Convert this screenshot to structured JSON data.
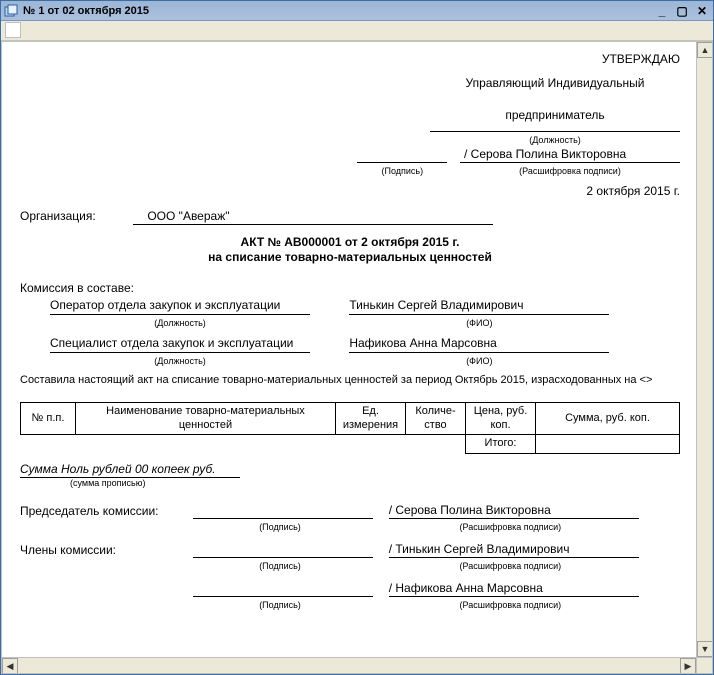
{
  "window": {
    "title": "№ 1 от 02 октября 2015"
  },
  "approve": {
    "header": "УТВЕРЖДАЮ",
    "position": "Управляющий Индивидуальный предприниматель",
    "position_caption": "(Должность)",
    "name": "/ Серова Полина Викторовна",
    "sign_caption": "(Подпись)",
    "name_caption": "(Расшифровка подписи)",
    "date": "2 октября 2015 г."
  },
  "org": {
    "label": "Организация:",
    "value": "ООО \"Авераж\""
  },
  "title": {
    "line1": "АКТ № АВ000001 от 2 октября 2015 г.",
    "line2": "на списание товарно-материальных ценностей"
  },
  "committee": {
    "label": "Комиссия в составе:",
    "pos_caption": "(Должность)",
    "fio_caption": "(ФИО)",
    "members": [
      {
        "position": "Оператор отдела закупок и эксплуатации",
        "fio": "Тинькин Сергей Владимирович"
      },
      {
        "position": "Специалист отдела закупок и эксплуатации",
        "fio": "Нафикова Анна Марсовна"
      }
    ]
  },
  "paragraph": "Составила настоящий акт на списание товарно-материальных ценностей за период Октябрь 2015, израсходованных на <>",
  "table": {
    "headers": {
      "num": "№ п.п.",
      "name": "Наименование товарно-материальных ценностей",
      "unit": "Ед. измерения",
      "qty": "Количе-\nство",
      "price": "Цена, руб. коп.",
      "sum": "Сумма, руб. коп."
    },
    "rows": [],
    "total_label": "Итого:"
  },
  "sum_words": {
    "value": "Сумма Ноль рублей 00 копеек руб.",
    "caption": "(сумма прописью)"
  },
  "signatures": {
    "chairman_label": "Председатель комиссии:",
    "members_label": "Члены комиссии:",
    "sign_caption": "(Подпись)",
    "name_caption": "(Расшифровка подписи)",
    "lines": [
      {
        "name": "/ Серова Полина Викторовна"
      },
      {
        "name": "/ Тинькин Сергей Владимирович"
      },
      {
        "name": "/ Нафикова Анна Марсовна"
      }
    ]
  }
}
